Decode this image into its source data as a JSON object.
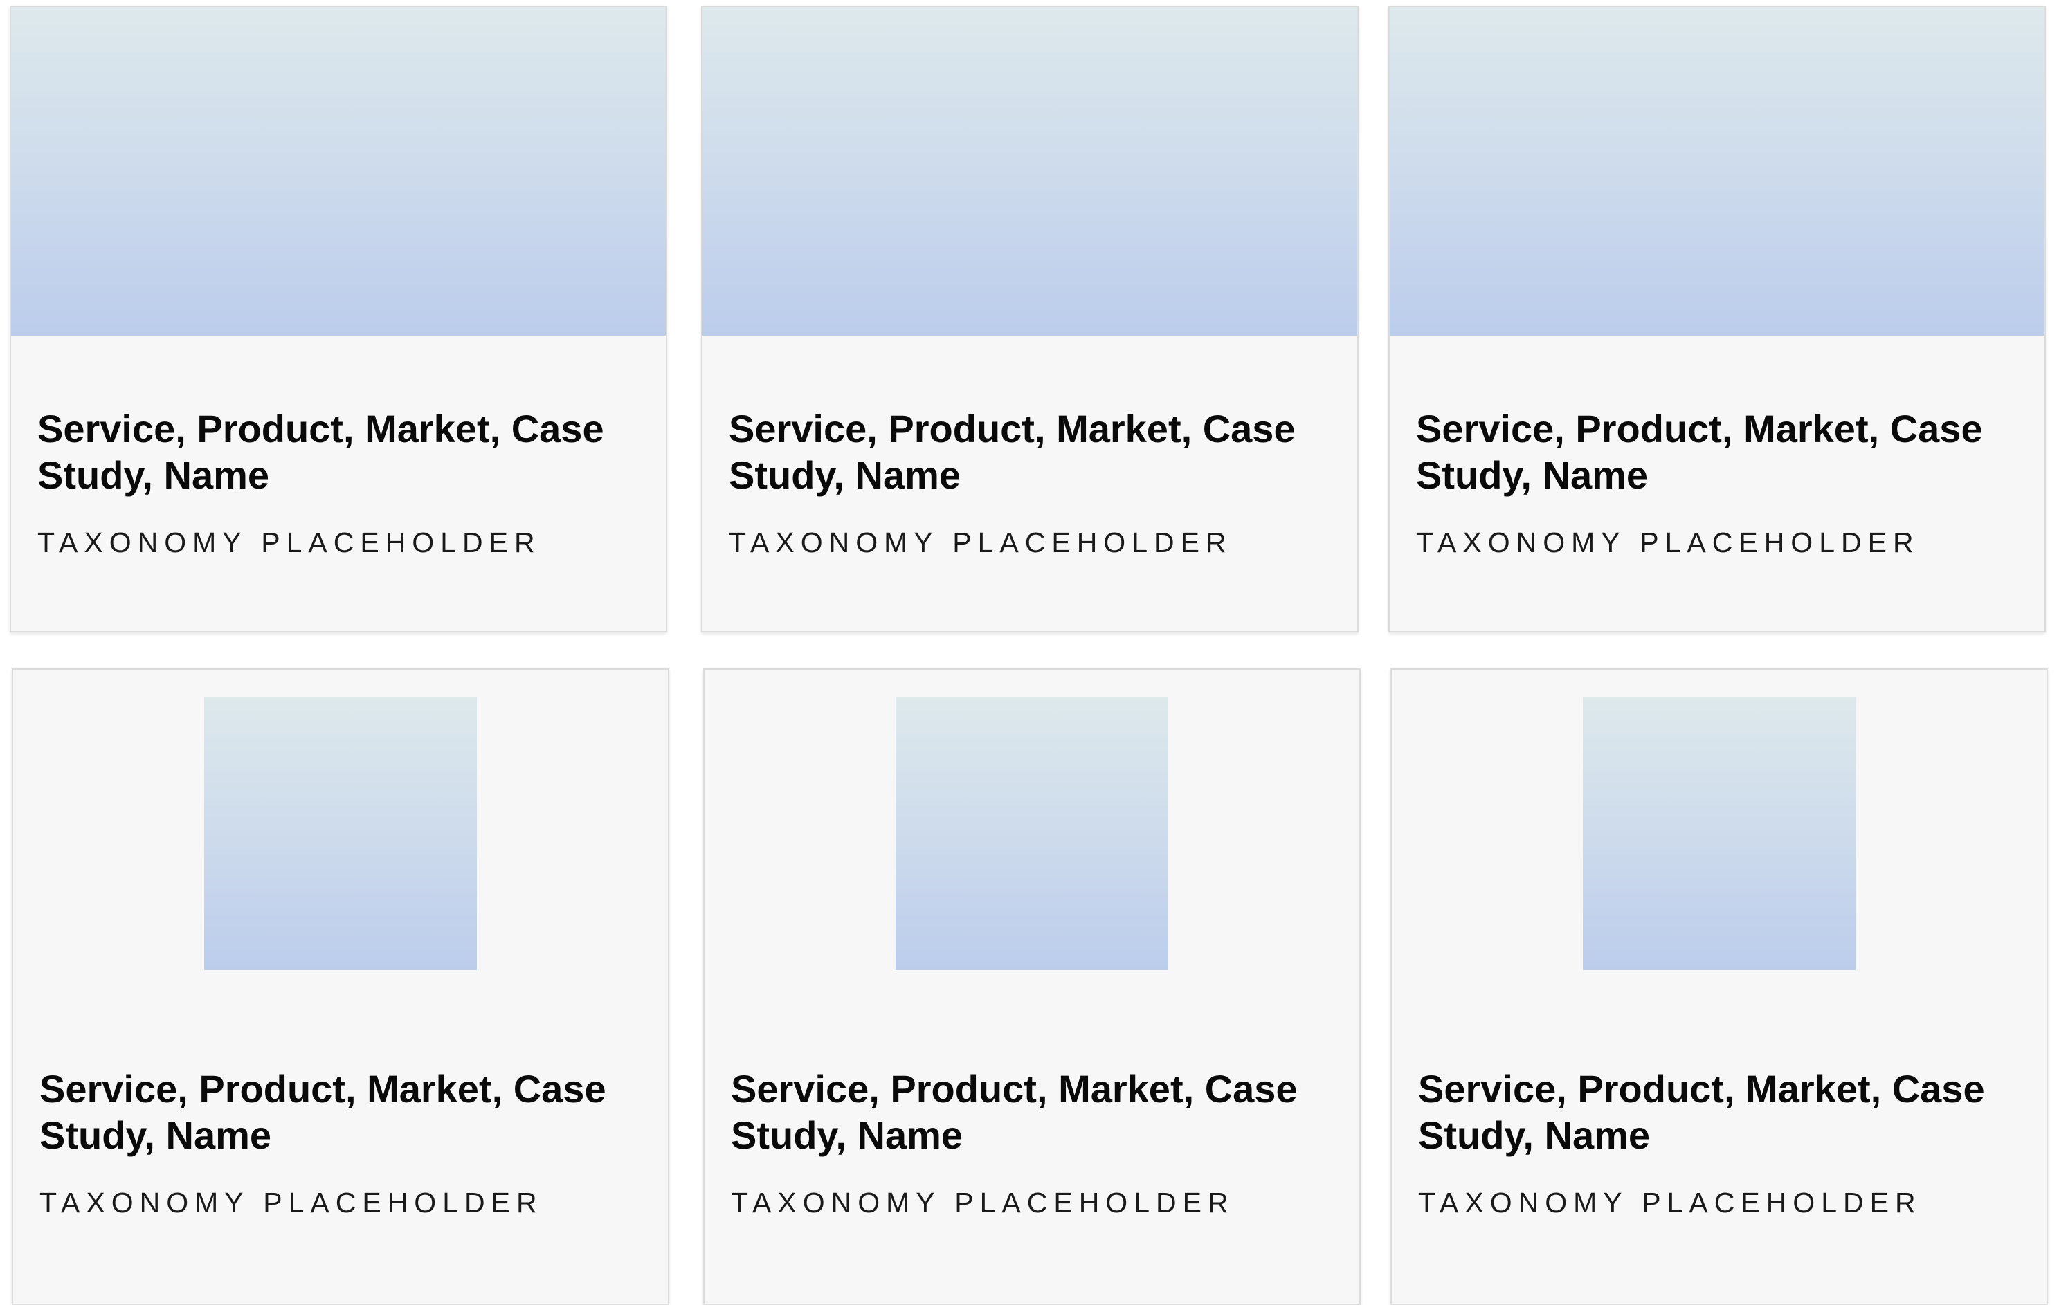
{
  "cards": [
    {
      "title": "Service, Product, Market, Case Study, Name",
      "taxonomy": "TAXONOMY PLACEHOLDER"
    },
    {
      "title": "Service, Product, Market, Case Study, Name",
      "taxonomy": "TAXONOMY PLACEHOLDER"
    },
    {
      "title": "Service, Product, Market, Case Study, Name",
      "taxonomy": "TAXONOMY PLACEHOLDER"
    },
    {
      "title": "Service, Product, Market, Case Study, Name",
      "taxonomy": "TAXONOMY PLACEHOLDER"
    },
    {
      "title": "Service, Product, Market, Case Study, Name",
      "taxonomy": "TAXONOMY PLACEHOLDER"
    },
    {
      "title": "Service, Product, Market, Case Study, Name",
      "taxonomy": "TAXONOMY PLACEHOLDER"
    }
  ],
  "colors": {
    "image_gradient_top": "#dee9ec",
    "image_gradient_bottom": "#bccdec",
    "card_background": "#f7f7f7",
    "card_border": "#dcdcdc"
  }
}
